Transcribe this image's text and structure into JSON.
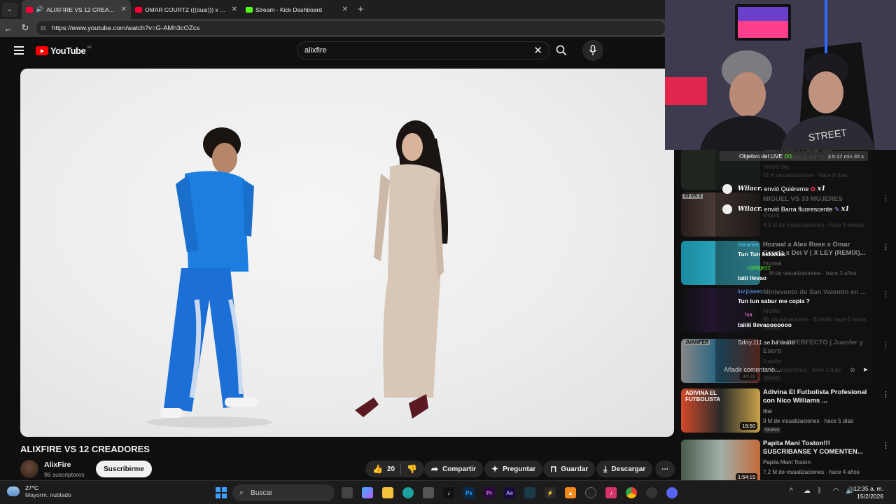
{
  "browser": {
    "tabs": [
      {
        "title": "ALIXFIRE VS 12 CREADORES",
        "active": true,
        "favicon_color": "#ff0033"
      },
      {
        "title": "OMAR COURTZ (((ousi))) x KARBeat",
        "active": false,
        "favicon_color": "#ff0033"
      },
      {
        "title": "Stream - Kick Dashboard",
        "active": false,
        "favicon_color": "#53fc18"
      }
    ],
    "url": "https://www.youtube.com/watch?v=G-AMh3cOZcs"
  },
  "youtube": {
    "logo_text": "YouTube",
    "country": "VE",
    "search_value": "alixfire",
    "video_title": "ALIXFIRE VS 12 CREADORES",
    "channel": "AlixFire",
    "subscribers": "96 suscriptores",
    "subscribe_label": "Suscribirme",
    "likes": "20",
    "actions": {
      "share": "Compartir",
      "ask": "Preguntar",
      "save": "Guardar",
      "download": "Descargar"
    }
  },
  "related": [
    {
      "title": "...WA ATAPPI UNIPOL. SEGUIDORES #4 *2 parte...",
      "channel": "Valero Sky",
      "meta": "41 K visualizaciones · hace 9 días",
      "duration": "",
      "badge": ""
    },
    {
      "title": "MIGUEL VS 33 MUJERES",
      "channel": "Miguel",
      "meta": "4,3 M de visualizaciones · hace 4 meses",
      "duration": "",
      "badge": "",
      "thumb_label": "33 VS 1"
    },
    {
      "title": "Hozwal x Alex Rose x Omar Courtz x Dei V | X LEY (REMIX)...",
      "channel": "Hozwal",
      "meta": "... M de visualizaciones · hace 3 años",
      "duration": "",
      "badge": ""
    },
    {
      "title": "Minievento de San Valentín en ...",
      "channel": "Nickfer",
      "meta": "85 visualizaciones · Emitido hace 6 horas",
      "duration": "",
      "badge": "Nuevo"
    },
    {
      "title": "... 2 PA 2 PERFECTO | Juanfer y Escro",
      "channel": "Juanfer",
      "meta": "... visualizaciones · hace 2 días",
      "duration": "34:26",
      "badge": "Nuevo",
      "thumb_label": "JUANFER"
    },
    {
      "title": "Adivina El Futbolista Profesional con Nico Williams ...",
      "channel": "Ibai",
      "meta": "3 M de visualizaciones · hace 5 días",
      "duration": "19:50",
      "badge": "Nuevo",
      "thumb_label": "ADIVINA EL FUTBOLISTA"
    },
    {
      "title": "Papita Mani Toston!!! SUSCRIBANSE Y COMENTEN...",
      "channel": "Papita Mani Toston",
      "meta": "7,2 M de visualizaciones · hace 4 años",
      "duration": "1:54:19",
      "badge": ""
    }
  ],
  "chat": {
    "goal_label": "Objetivo del LIVE",
    "goal_value": "0/1",
    "goal_time": "3 h 27 min 35 s",
    "gifts": [
      {
        "user": "Wilacr.",
        "text": "envió Quiéreme",
        "count": "x1"
      },
      {
        "user": "Wilacr.",
        "text": "envió Barra fluorescente",
        "count": "x1"
      }
    ],
    "messages": [
      {
        "user": "zacarias",
        "text": "Tun Tun kkkkkkk",
        "color": "#53c8fc"
      },
      {
        "user": "rodrigezz",
        "text": "taiii llevao",
        "color": "#53fc18"
      },
      {
        "user": "luv.joseeo",
        "text": "Tun tun sabur me copia ?",
        "color": "#5ba8ff"
      },
      {
        "user": "Isa",
        "text": "taiiiii llevaooooooo",
        "color": "#ff7ad9"
      }
    ],
    "join_text": "Sdrry.111 se ha unido",
    "input_placeholder": "Añadir comentario..."
  },
  "taskbar": {
    "temp": "27°C",
    "weather": "Mayorm. nublado",
    "search": "Buscar",
    "time": "12:35 a. m.",
    "date": "15/2/2026"
  }
}
